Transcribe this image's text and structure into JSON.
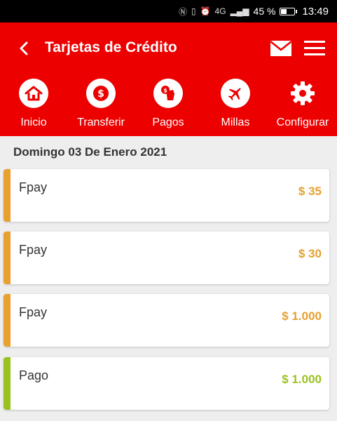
{
  "status": {
    "network": "4G",
    "battery": "45 %",
    "battery_level": 0.45,
    "time": "13:49"
  },
  "header": {
    "title": "Tarjetas de Crédito"
  },
  "nav": [
    {
      "label": "Inicio",
      "icon": "home-icon"
    },
    {
      "label": "Transferir",
      "icon": "dollar-icon"
    },
    {
      "label": "Pagos",
      "icon": "payment-hand-icon"
    },
    {
      "label": "Millas",
      "icon": "airplane-icon"
    },
    {
      "label": "Configurar",
      "icon": "gear-icon"
    }
  ],
  "date_header": "Domingo 03 De Enero 2021",
  "transactions": [
    {
      "name": "Fpay",
      "amount": "$ 35",
      "color": "#e8a02e"
    },
    {
      "name": "Fpay",
      "amount": "$ 30",
      "color": "#e8a02e"
    },
    {
      "name": "Fpay",
      "amount": "$ 1.000",
      "color": "#e8a02e"
    },
    {
      "name": "Pago",
      "amount": "$ 1.000",
      "color": "#9ac21f"
    }
  ],
  "colors": {
    "brand": "#ec0000",
    "debit": "#e8a02e",
    "credit": "#9ac21f"
  }
}
